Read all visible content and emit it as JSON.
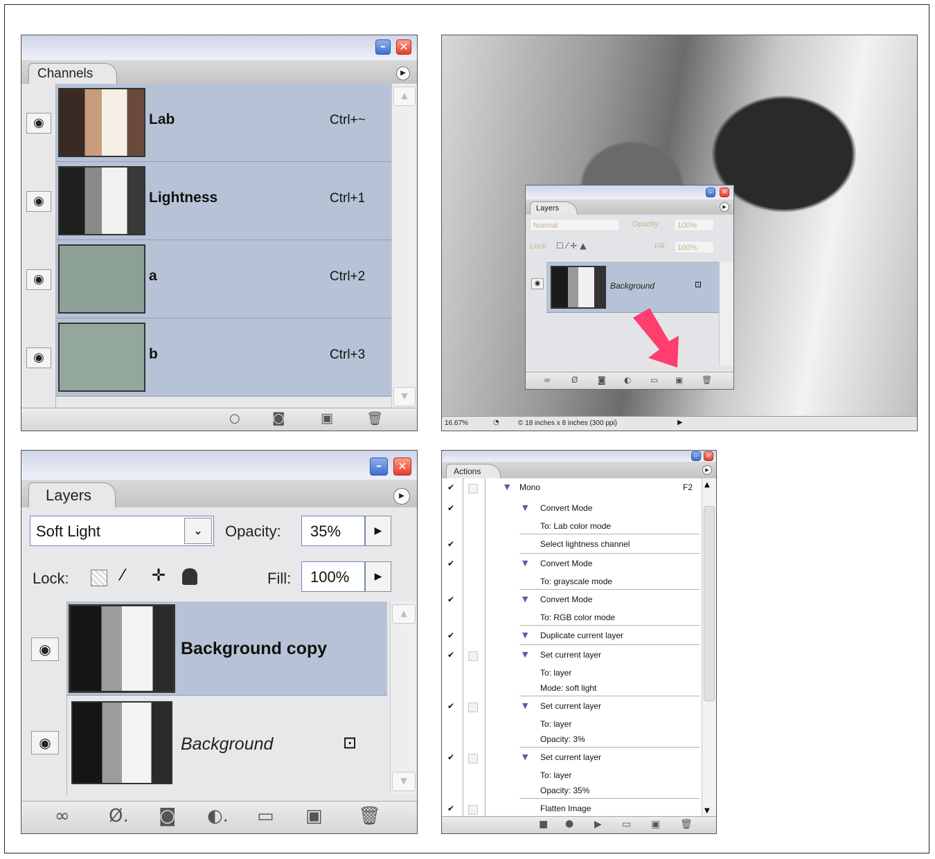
{
  "channels_panel": {
    "tab": "Channels",
    "channels": [
      {
        "name": "Lab",
        "shortcut": "Ctrl+~"
      },
      {
        "name": "Lightness",
        "shortcut": "Ctrl+1"
      },
      {
        "name": "a",
        "shortcut": "Ctrl+2"
      },
      {
        "name": "b",
        "shortcut": "Ctrl+3"
      }
    ],
    "footer_icons": [
      "selection-circle-icon",
      "save-mask-icon",
      "new-channel-icon",
      "trash-icon"
    ]
  },
  "photo_window": {
    "status": {
      "zoom": "16.67%",
      "doc_info": "© 18 inches x 8 inches (300 ppi)"
    },
    "mini_layers": {
      "tab": "Layers",
      "blend_mode": "Normal",
      "opacity_label": "Opacity:",
      "opacity_value": "100%",
      "lock_label": "Lock:",
      "fill_label": "Fill:",
      "fill_value": "100%",
      "layer_name": "Background"
    },
    "arrow_color": "#ff3d6e"
  },
  "layers_panel": {
    "tab": "Layers",
    "blend_mode": "Soft Light",
    "opacity_label": "Opacity:",
    "opacity_value": "35%",
    "lock_label": "Lock:",
    "fill_label": "Fill:",
    "fill_value": "100%",
    "layers": [
      {
        "name": "Background copy",
        "selected": true
      },
      {
        "name": "Background",
        "locked": true
      }
    ],
    "selection_color": "#b6c3d6"
  },
  "actions_panel": {
    "tab": "Actions",
    "items": [
      {
        "text": "Mono",
        "shortcut": "F2"
      },
      {
        "text": "Convert Mode"
      },
      {
        "text": "To: Lab color mode"
      },
      {
        "text": "Select lightness channel"
      },
      {
        "text": "Convert Mode"
      },
      {
        "text": "To: grayscale mode"
      },
      {
        "text": "Convert Mode"
      },
      {
        "text": "To: RGB color mode"
      },
      {
        "text": "Duplicate current layer"
      },
      {
        "text": "Set current layer"
      },
      {
        "text": "To: layer"
      },
      {
        "text": "Mode: soft light"
      },
      {
        "text": "Set current layer"
      },
      {
        "text": "To: layer"
      },
      {
        "text": "Opacity: 3%"
      },
      {
        "text": "Set current layer"
      },
      {
        "text": "To: layer"
      },
      {
        "text": "Opacity: 35%"
      },
      {
        "text": "Flatten Image"
      }
    ]
  }
}
